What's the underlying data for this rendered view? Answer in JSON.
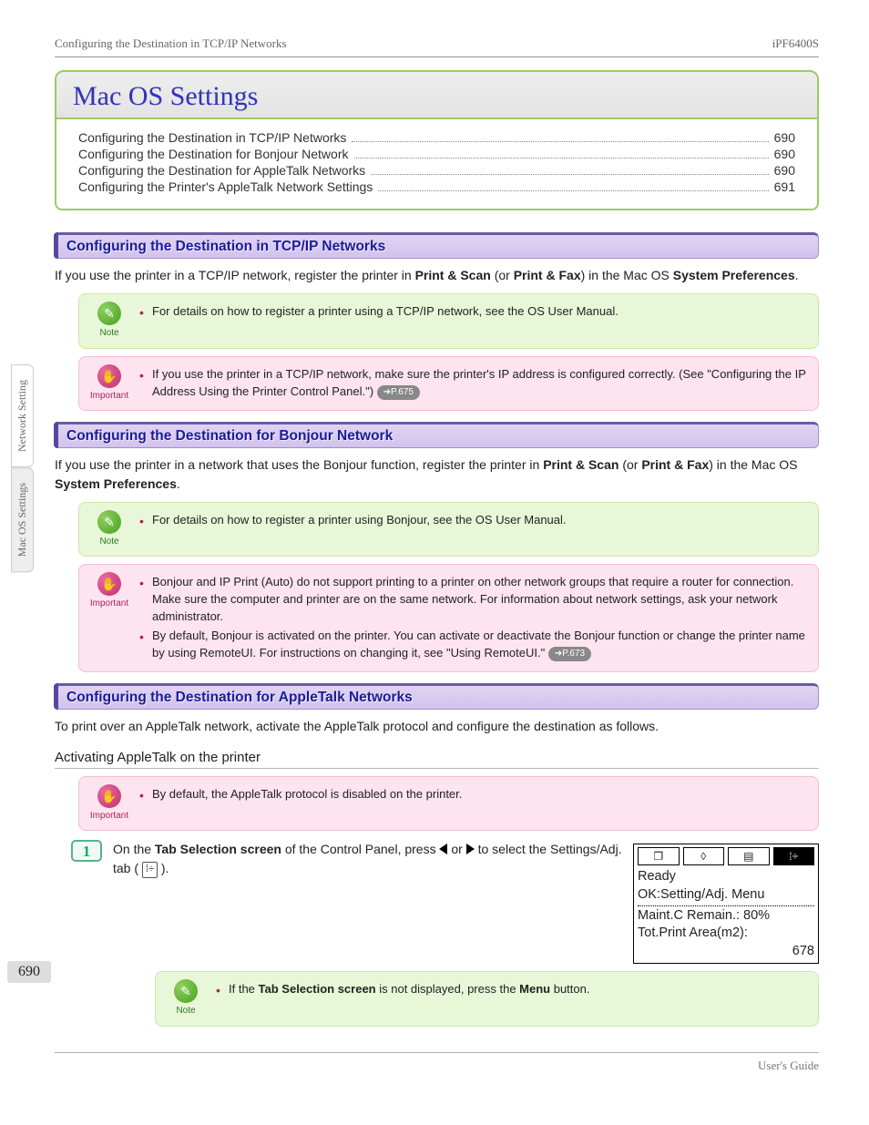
{
  "header": {
    "left": "Configuring the Destination in TCP/IP Networks",
    "right": "iPF6400S"
  },
  "side_tabs": {
    "a": "Network Setting",
    "b": "Mac OS Settings"
  },
  "page_number": "690",
  "title": "Mac OS Settings",
  "toc": [
    {
      "title": "Configuring the Destination in TCP/IP Networks",
      "page": "690"
    },
    {
      "title": "Configuring the Destination for Bonjour Network",
      "page": "690"
    },
    {
      "title": "Configuring the Destination for AppleTalk Networks",
      "page": "690"
    },
    {
      "title": "Configuring the Printer's AppleTalk Network Settings",
      "page": "691"
    }
  ],
  "labels": {
    "note": "Note",
    "important": "Important"
  },
  "s1": {
    "head": "Configuring the Destination in TCP/IP Networks",
    "p_a": "If you use the printer in a TCP/IP network, register the printer in ",
    "p_b": "Print & Scan",
    "p_c": " (or ",
    "p_d": "Print & Fax",
    "p_e": ") in the Mac OS ",
    "p_f": "System Preferences",
    "p_g": ".",
    "note1": "For details on how to register a printer using a TCP/IP network, see the OS User Manual.",
    "imp1_a": "If you use the printer in a TCP/IP network, make sure the printer's IP address is configured correctly.  (See \"Configuring the IP Address Using the Printer Control Panel.\") ",
    "imp1_pill": "➔P.675"
  },
  "s2": {
    "head": "Configuring the Destination for Bonjour Network",
    "p_a": "If you use the printer in a network that uses the Bonjour function, register the printer in ",
    "p_b": "Print & Scan",
    "p_c": " (or ",
    "p_d": "Print & Fax",
    "p_e": ") in the Mac OS ",
    "p_f": "System Preferences",
    "p_g": ".",
    "note1": "For details on how to register a printer using Bonjour, see the OS User Manual.",
    "imp1": "Bonjour and IP Print (Auto) do not support printing to a printer on other network groups that require a router for connection. Make sure the computer and printer are on the same network. For information about network settings, ask your network administrator.",
    "imp2_a": "By default, Bonjour is activated on the printer. You can activate or deactivate the Bonjour function or change the printer name by using RemoteUI. For instructions on changing it, see \"Using RemoteUI.\" ",
    "imp2_pill": "➔P.673"
  },
  "s3": {
    "head": "Configuring the Destination for AppleTalk Networks",
    "p": "To print over an AppleTalk network, activate the AppleTalk protocol and configure the destination as follows.",
    "sub": "Activating AppleTalk on the printer",
    "imp1": "By default, the AppleTalk protocol is disabled on the printer.",
    "step1_num": "1",
    "step1_a": "On the ",
    "step1_b": "Tab Selection screen",
    "step1_c": " of the Control Panel, press ",
    "step1_d": " or ",
    "step1_e": " to select the Settings/Adj. tab ( ",
    "step1_f": " ).",
    "lcd": {
      "line1": "Ready",
      "line2": "OK:Setting/Adj. Menu",
      "line3": "Maint.C Remain.: 80%",
      "line4": "Tot.Print Area(m2):",
      "line5": "678"
    },
    "note2_a": "If the ",
    "note2_b": "Tab Selection screen",
    "note2_c": " is not displayed, press the ",
    "note2_d": "Menu",
    "note2_e": " button."
  },
  "footer": "User's Guide"
}
